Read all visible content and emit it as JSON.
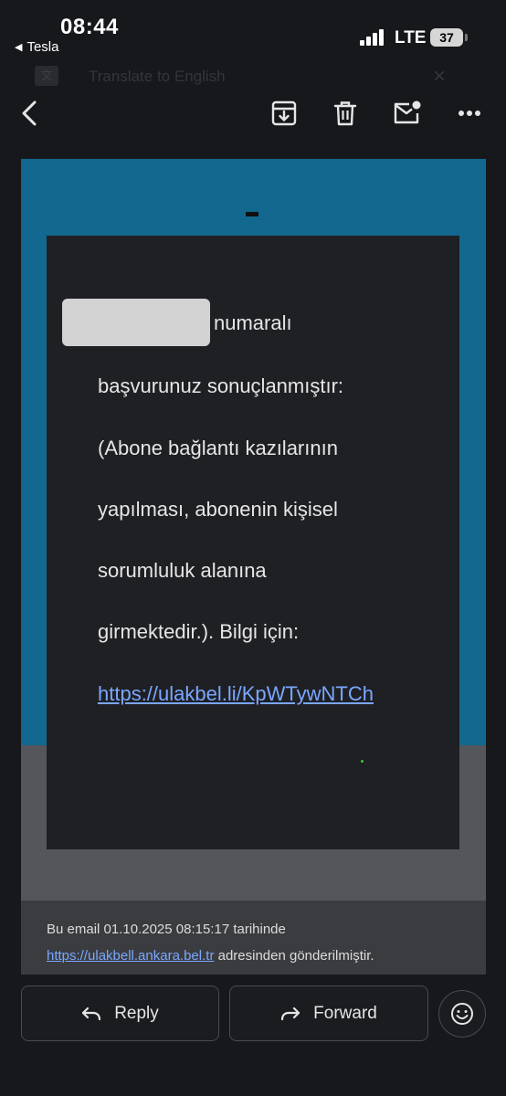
{
  "status_bar": {
    "time": "08:44",
    "back_app": "Tesla",
    "network": "LTE",
    "battery": "37"
  },
  "translate_banner": {
    "text": "Translate to English",
    "close": "×"
  },
  "toolbar": {
    "icons": [
      "back-arrow-icon",
      "archive-icon",
      "trash-icon",
      "mark-unread-icon",
      "more-icon"
    ]
  },
  "email": {
    "lines": [
      "numaralı",
      "başvurunuz sonuçlanmıştır:",
      "(Abone bağlantı kazılarının",
      "yapılması, abonenin kişisel",
      "sorumluluk alanına",
      "girmektedir.). Bilgi için:"
    ],
    "link": "https://ulakbel.li/KpWTywNTCh",
    "footer_prefix": "Bu email 01.10.2025 08:15:17 tarihinde",
    "footer_link": "https://ulakbell.ankara.bel.tr",
    "footer_suffix": " adresinden gönderilmiştir."
  },
  "actions": {
    "reply": "Reply",
    "forward": "Forward"
  },
  "colors": {
    "blue_band": "#12688f",
    "card": "#1f2024",
    "link": "#7aa7ff"
  }
}
